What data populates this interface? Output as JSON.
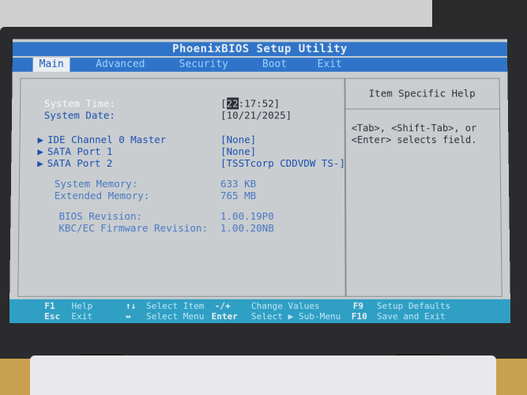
{
  "title": "PhoenixBIOS Setup Utility",
  "menu": [
    "Main",
    "Advanced",
    "Security",
    "Boot",
    "Exit"
  ],
  "main": {
    "system_time_label": "System Time:",
    "system_time_cursor": "22",
    "system_time_rest": ":17:52",
    "system_date_label": "System Date:",
    "system_date_value": "[10/21/2025]",
    "submenus": [
      {
        "label": "IDE Channel 0 Master",
        "value": "[None]"
      },
      {
        "label": "SATA Port 1",
        "value": "[None]"
      },
      {
        "label": "SATA Port 2",
        "value": "[TSSTcorp CDDVDW TS-]"
      }
    ],
    "info": [
      {
        "label": "System Memory:",
        "value": "633 KB"
      },
      {
        "label": "Extended Memory:",
        "value": "765 MB"
      },
      {
        "label": "BIOS Revision:",
        "value": "1.00.19P0"
      },
      {
        "label": "KBC/EC Firmware Revision:",
        "value": "1.00.20NB"
      }
    ],
    "submenu_arrow": "▶"
  },
  "help": {
    "title": "Item Specific Help",
    "text": "<Tab>, <Shift-Tab>, or <Enter> selects field."
  },
  "status": {
    "f1_key": "F1",
    "f1_text": "Help",
    "esc_key": "Esc",
    "esc_text": "Exit",
    "ud_key": "↑↓",
    "ud_text": "Select Item",
    "lr_key": "↔",
    "lr_text": "Select Menu",
    "pm_key": "-/+",
    "pm_text": "Change Values",
    "enter_key": "Enter",
    "enter_text": "Select ▶ Sub-Menu",
    "f9_key": "F9",
    "f9_text": "Setup Defaults",
    "f10_key": "F10",
    "f10_text": "Save and Exit"
  }
}
